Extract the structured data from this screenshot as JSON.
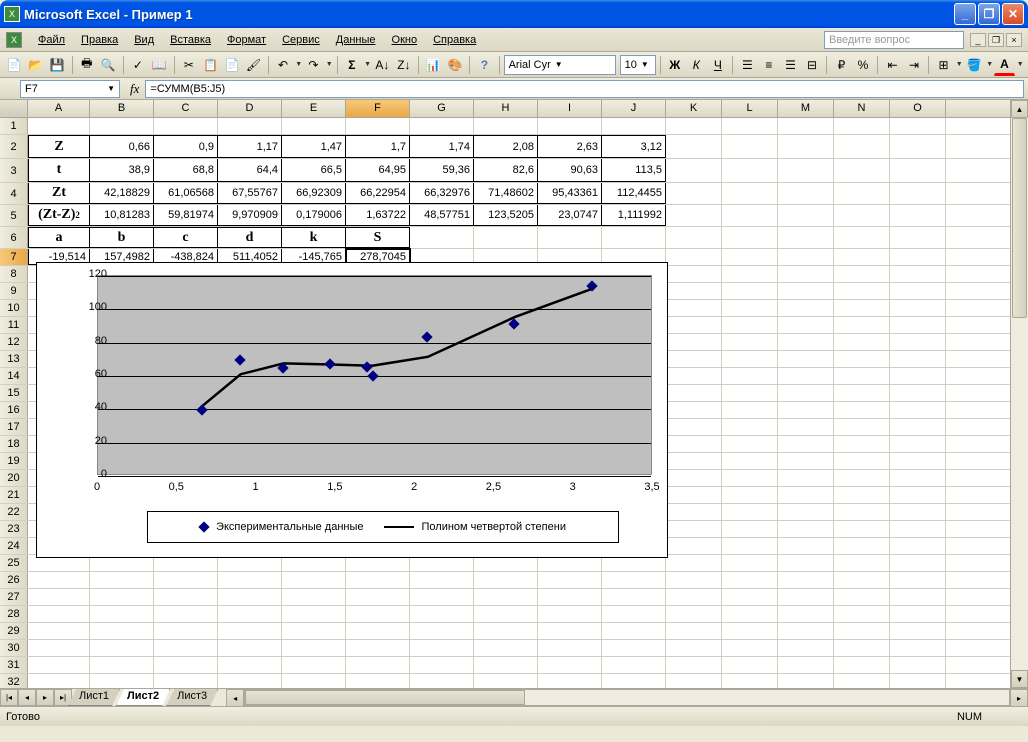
{
  "title": "Microsoft Excel - Пример 1",
  "menus": {
    "file": "Файл",
    "edit": "Правка",
    "view": "Вид",
    "insert": "Вставка",
    "format": "Формат",
    "service": "Сервис",
    "data": "Данные",
    "window": "Окно",
    "help": "Справка"
  },
  "ask_placeholder": "Введите вопрос",
  "font": {
    "name": "Arial Cyr",
    "size": "10"
  },
  "namebox": "F7",
  "formula": "=СУММ(B5:J5)",
  "columns": [
    "A",
    "B",
    "C",
    "D",
    "E",
    "F",
    "G",
    "H",
    "I",
    "J",
    "K",
    "L",
    "M",
    "N",
    "O"
  ],
  "rows": 32,
  "selected": {
    "col": "F",
    "row": 7
  },
  "tabledata": {
    "labels": {
      "Z": "Z",
      "t": "t",
      "Zt": "Zt",
      "ZtZ": "(Zt-Z)",
      "a": "a",
      "b": "b",
      "c": "c",
      "d": "d",
      "k": "k",
      "S": "S"
    },
    "Z": [
      "0,66",
      "0,9",
      "1,17",
      "1,47",
      "1,7",
      "1,74",
      "2,08",
      "2,63",
      "3,12"
    ],
    "t": [
      "38,9",
      "68,8",
      "64,4",
      "66,5",
      "64,95",
      "59,36",
      "82,6",
      "90,63",
      "113,5"
    ],
    "Zt": [
      "42,18829",
      "61,06568",
      "67,55767",
      "66,92309",
      "66,22954",
      "66,32976",
      "71,48602",
      "95,43361",
      "112,4455"
    ],
    "ZtZ": [
      "10,81283",
      "59,81974",
      "9,970909",
      "0,179006",
      "1,63722",
      "48,57751",
      "123,5205",
      "23,0747",
      "1,111992"
    ],
    "coef": [
      "-19,514",
      "157,4982",
      "-438,824",
      "511,4052",
      "-145,765",
      "278,7045"
    ]
  },
  "chart_data": {
    "type": "scatter",
    "title": "",
    "xlabel": "",
    "ylabel": "",
    "xlim": [
      0,
      3.5
    ],
    "ylim": [
      0,
      120
    ],
    "xticks": [
      0,
      0.5,
      1,
      1.5,
      2,
      2.5,
      3,
      3.5
    ],
    "yticks": [
      0,
      20,
      40,
      60,
      80,
      100,
      120
    ],
    "series": [
      {
        "name": "Экспериментальные данные",
        "type": "scatter",
        "x": [
          0.66,
          0.9,
          1.17,
          1.47,
          1.7,
          1.74,
          2.08,
          2.63,
          3.12
        ],
        "y": [
          38.9,
          68.8,
          64.4,
          66.5,
          64.95,
          59.36,
          82.6,
          90.63,
          113.5
        ]
      },
      {
        "name": "Полином четвертой степени",
        "type": "line",
        "x": [
          0.66,
          0.9,
          1.17,
          1.47,
          1.7,
          1.74,
          2.08,
          2.63,
          3.12
        ],
        "y": [
          42.19,
          61.07,
          67.56,
          66.92,
          66.23,
          66.33,
          71.49,
          95.43,
          112.45
        ]
      }
    ]
  },
  "sheets": {
    "s1": "Лист1",
    "s2": "Лист2",
    "s3": "Лист3"
  },
  "status": "Готово",
  "numlock": "NUM"
}
